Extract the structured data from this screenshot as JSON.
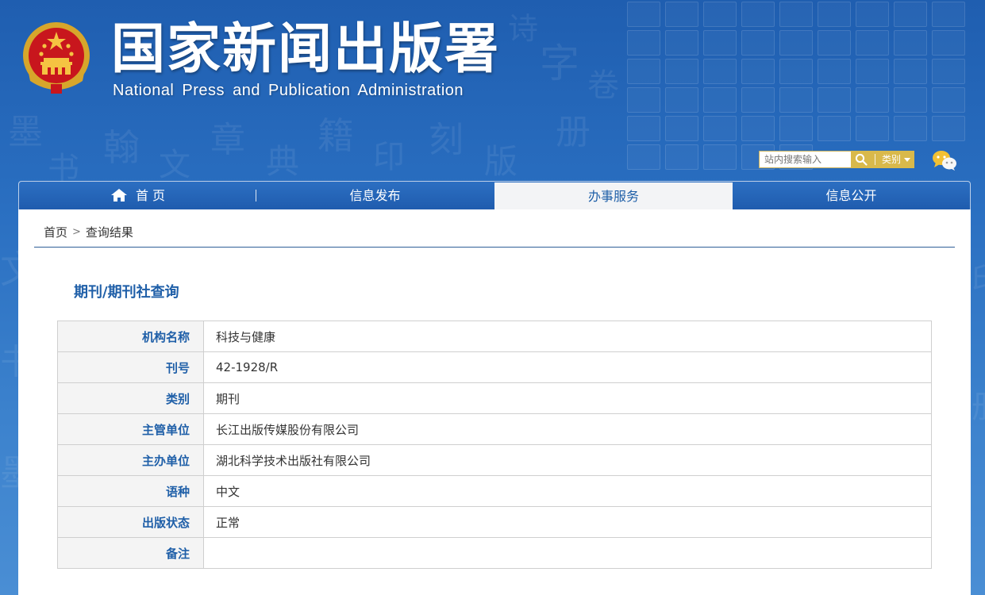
{
  "header": {
    "title": "国家新闻出版署",
    "subtitle": "National  Press and Publication Administration"
  },
  "search": {
    "placeholder": "站内搜索输入",
    "category_label": "类别"
  },
  "icons": {
    "emblem": "national-emblem-icon",
    "search": "search-icon",
    "dropdown": "caret-down-icon",
    "wechat": "wechat-icon",
    "home": "home-icon"
  },
  "nav": {
    "items": [
      {
        "label": "首 页",
        "active": false
      },
      {
        "label": "信息发布",
        "active": false
      },
      {
        "label": "办事服务",
        "active": true
      },
      {
        "label": "信息公开",
        "active": false
      }
    ]
  },
  "breadcrumb": {
    "home": "首页",
    "separator": ">",
    "current": "查询结果"
  },
  "section_title": "期刊/期刊社查询",
  "record": [
    {
      "key": "机构名称",
      "value": "科技与健康"
    },
    {
      "key": "刊号",
      "value": "42-1928/R"
    },
    {
      "key": "类别",
      "value": "期刊"
    },
    {
      "key": "主管单位",
      "value": "长江出版传媒股份有限公司"
    },
    {
      "key": "主办单位",
      "value": "湖北科学技术出版社有限公司"
    },
    {
      "key": "语种",
      "value": "中文"
    },
    {
      "key": "出版状态",
      "value": "正常"
    },
    {
      "key": "备注",
      "value": ""
    }
  ],
  "colors": {
    "brand_blue": "#1f5fa8",
    "header_blue": "#2a6fc1",
    "gold": "#d9b94b"
  }
}
